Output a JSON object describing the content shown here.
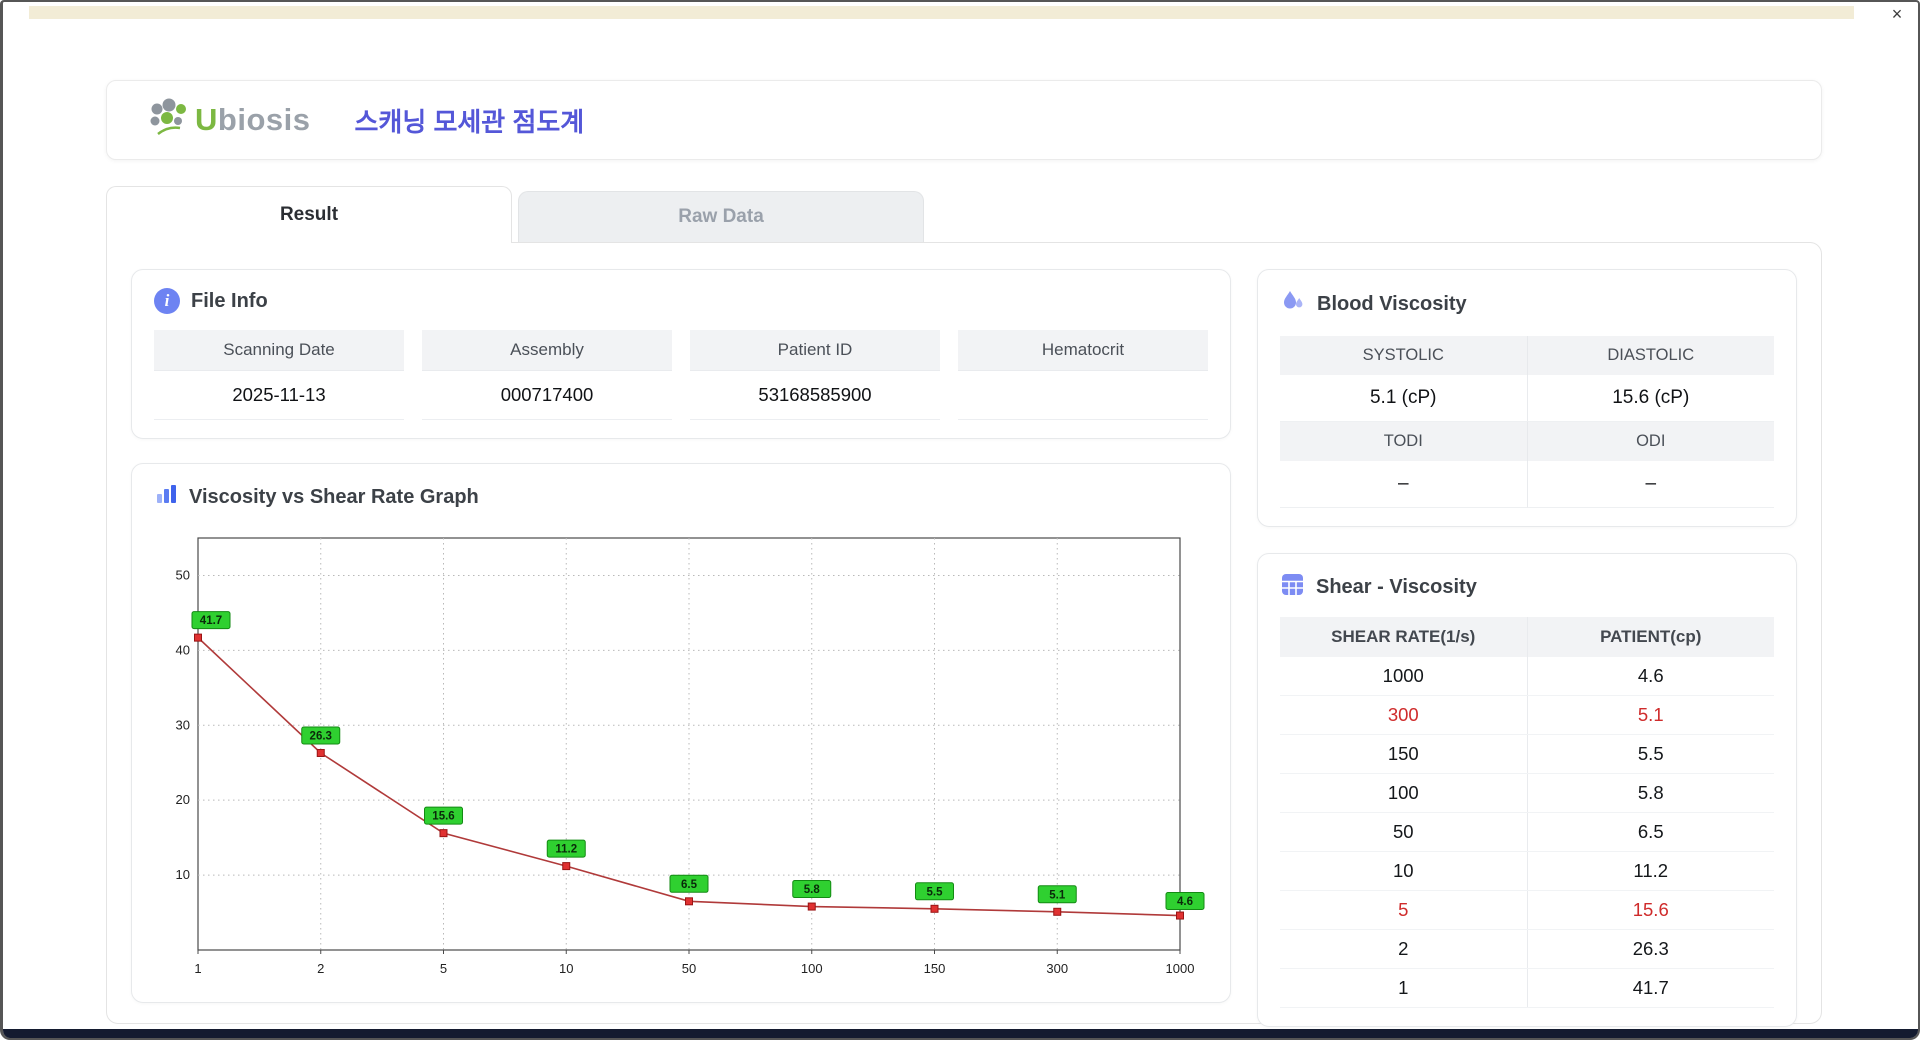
{
  "window": {
    "close_icon": "×"
  },
  "header": {
    "logo_u": "U",
    "logo_rest": "biosis",
    "title": "스캐닝 모세관 점도계"
  },
  "tabs": [
    {
      "label": "Result",
      "active": true
    },
    {
      "label": "Raw Data",
      "active": false
    }
  ],
  "file_info": {
    "title": "File Info",
    "fields": [
      {
        "label": "Scanning Date",
        "value": "2025-11-13"
      },
      {
        "label": "Assembly",
        "value": "000717400"
      },
      {
        "label": "Patient ID",
        "value": "53168585900"
      },
      {
        "label": "Hematocrit",
        "value": ""
      }
    ]
  },
  "blood_viscosity": {
    "title": "Blood Viscosity",
    "rows": [
      {
        "headers": [
          "SYSTOLIC",
          "DIASTOLIC"
        ],
        "values": [
          "5.1 (cP)",
          "15.6 (cP)"
        ]
      },
      {
        "headers": [
          "TODI",
          "ODI"
        ],
        "values": [
          "–",
          "–"
        ]
      }
    ]
  },
  "graph": {
    "title": "Viscosity vs Shear Rate Graph"
  },
  "chart_data": {
    "type": "line",
    "title": "Viscosity vs Shear Rate Graph",
    "xlabel": "",
    "ylabel": "",
    "x_scale": "category",
    "x": [
      1,
      2,
      5,
      10,
      50,
      100,
      150,
      300,
      1000
    ],
    "x_tick_labels": [
      "1",
      "2",
      "5",
      "10",
      "50",
      "100",
      "150",
      "300",
      "1000"
    ],
    "values": [
      41.7,
      26.3,
      15.6,
      11.2,
      6.5,
      5.8,
      5.5,
      5.1,
      4.6
    ],
    "point_labels": [
      "41.7",
      "26.3",
      "15.6",
      "11.2",
      "6.5",
      "5.8",
      "5.5",
      "5.1",
      "4.6"
    ],
    "y_ticks": [
      10,
      20,
      30,
      40,
      50
    ],
    "ylim": [
      0,
      55
    ],
    "grid": "dotted",
    "line_color": "#b03a3a",
    "marker_color": "#e03131",
    "marker_stroke": "#991414",
    "label_bg": "#2fd030",
    "label_border": "#138a13",
    "label_text": "#0a2a0a"
  },
  "shear_table": {
    "title": "Shear - Viscosity",
    "columns": [
      "SHEAR RATE(1/s)",
      "PATIENT(cp)"
    ],
    "rows": [
      {
        "rate": "1000",
        "patient": "4.6",
        "highlight": false
      },
      {
        "rate": "300",
        "patient": "5.1",
        "highlight": true
      },
      {
        "rate": "150",
        "patient": "5.5",
        "highlight": false
      },
      {
        "rate": "100",
        "patient": "5.8",
        "highlight": false
      },
      {
        "rate": "50",
        "patient": "6.5",
        "highlight": false
      },
      {
        "rate": "10",
        "patient": "11.2",
        "highlight": false
      },
      {
        "rate": "5",
        "patient": "15.6",
        "highlight": true
      },
      {
        "rate": "2",
        "patient": "26.3",
        "highlight": false
      },
      {
        "rate": "1",
        "patient": "41.7",
        "highlight": false
      }
    ]
  },
  "colors": {
    "accent_title": "#5457d8",
    "logo_green": "#7cb842",
    "logo_gray": "#9aa1a9",
    "highlight_red": "#cf2b2b",
    "icon_indigo": "#6d83f2"
  }
}
